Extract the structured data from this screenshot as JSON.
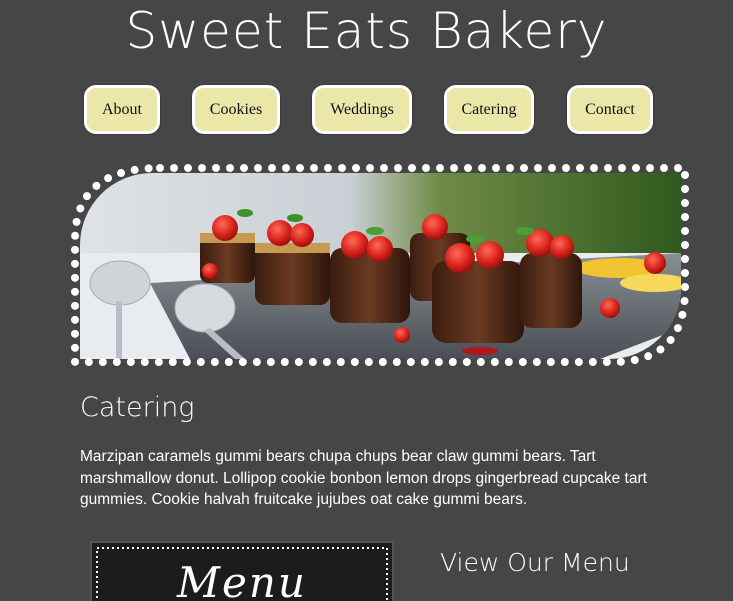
{
  "header": {
    "title": "Sweet Eats Bakery"
  },
  "nav": {
    "items": [
      {
        "label": "About"
      },
      {
        "label": "Cookies"
      },
      {
        "label": "Weddings"
      },
      {
        "label": "Catering"
      },
      {
        "label": "Contact"
      }
    ]
  },
  "main": {
    "heading": "Catering",
    "paragraph": "Marzipan caramels gummi bears chupa chups bear claw gummi bears. Tart marshmallow donut. Lollipop cookie bonbon lemon drops gingerbread cupcake tart gummies. Cookie halvah fruitcake jujubes oat cake gummi bears.",
    "menu_board_text": "Menu",
    "menu_link": "View Our Menu"
  },
  "colors": {
    "background": "#464646",
    "nav_button": "#ebe7a9",
    "text": "#ffffff"
  }
}
